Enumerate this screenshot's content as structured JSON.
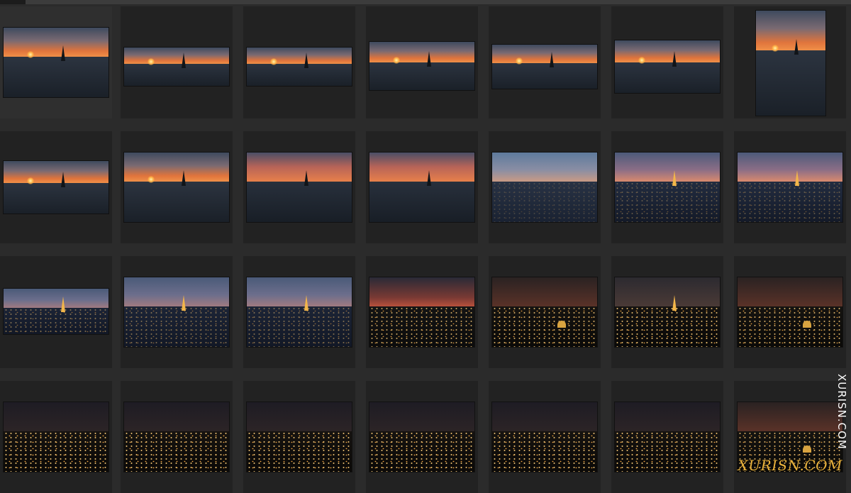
{
  "grid": {
    "columns": 7,
    "rows": 4,
    "thumbnails": [
      {
        "row": 0,
        "col": 0,
        "scene": "sunset-sun",
        "orientation": "landscape",
        "selected": true
      },
      {
        "row": 0,
        "col": 1,
        "scene": "sunset-sun",
        "orientation": "landscape",
        "selected": false
      },
      {
        "row": 0,
        "col": 2,
        "scene": "sunset-sun",
        "orientation": "landscape",
        "selected": false
      },
      {
        "row": 0,
        "col": 3,
        "scene": "sunset-sun",
        "orientation": "landscape",
        "selected": false
      },
      {
        "row": 0,
        "col": 4,
        "scene": "sunset-sun",
        "orientation": "landscape",
        "selected": false
      },
      {
        "row": 0,
        "col": 5,
        "scene": "sunset-sun",
        "orientation": "landscape",
        "selected": false
      },
      {
        "row": 0,
        "col": 6,
        "scene": "sunset-sun",
        "orientation": "portrait",
        "selected": false
      },
      {
        "row": 1,
        "col": 0,
        "scene": "sunset-sun",
        "orientation": "landscape",
        "selected": false
      },
      {
        "row": 1,
        "col": 1,
        "scene": "sunset-sun",
        "orientation": "landscape",
        "selected": false
      },
      {
        "row": 1,
        "col": 2,
        "scene": "sunset-glow",
        "orientation": "landscape",
        "selected": false
      },
      {
        "row": 1,
        "col": 3,
        "scene": "sunset-glow",
        "orientation": "landscape",
        "selected": false
      },
      {
        "row": 1,
        "col": 4,
        "scene": "dusk-blue",
        "orientation": "landscape",
        "selected": false
      },
      {
        "row": 1,
        "col": 5,
        "scene": "dusk-tower-lit",
        "orientation": "landscape",
        "selected": false
      },
      {
        "row": 1,
        "col": 6,
        "scene": "dusk-tower-lit",
        "orientation": "landscape",
        "selected": false
      },
      {
        "row": 2,
        "col": 0,
        "scene": "blue-hour",
        "orientation": "landscape",
        "selected": false
      },
      {
        "row": 2,
        "col": 1,
        "scene": "blue-hour",
        "orientation": "landscape",
        "selected": false
      },
      {
        "row": 2,
        "col": 2,
        "scene": "blue-hour",
        "orientation": "landscape",
        "selected": false
      },
      {
        "row": 2,
        "col": 3,
        "scene": "night-red-sky",
        "orientation": "landscape",
        "selected": false
      },
      {
        "row": 2,
        "col": 4,
        "scene": "night-dome",
        "orientation": "landscape",
        "selected": false
      },
      {
        "row": 2,
        "col": 5,
        "scene": "night-tower-lit",
        "orientation": "landscape",
        "selected": false
      },
      {
        "row": 2,
        "col": 6,
        "scene": "night-dome",
        "orientation": "landscape",
        "selected": false
      },
      {
        "row": 3,
        "col": 0,
        "scene": "night-city",
        "orientation": "landscape",
        "selected": false
      },
      {
        "row": 3,
        "col": 1,
        "scene": "night-city",
        "orientation": "landscape",
        "selected": false
      },
      {
        "row": 3,
        "col": 2,
        "scene": "night-city",
        "orientation": "landscape",
        "selected": false
      },
      {
        "row": 3,
        "col": 3,
        "scene": "night-city",
        "orientation": "landscape",
        "selected": false
      },
      {
        "row": 3,
        "col": 4,
        "scene": "night-city",
        "orientation": "landscape",
        "selected": false
      },
      {
        "row": 3,
        "col": 5,
        "scene": "night-city",
        "orientation": "landscape",
        "selected": false
      },
      {
        "row": 3,
        "col": 6,
        "scene": "night-dome",
        "orientation": "landscape",
        "selected": false
      }
    ]
  },
  "watermark": {
    "vertical_text": "XURISN.COM",
    "logo_text": "XURISN.COM",
    "logo_color": "#e8b13c"
  },
  "colors": {
    "background": "#2b2b2b",
    "cell": "#222222",
    "cell_selected": "#2f2f2f"
  }
}
